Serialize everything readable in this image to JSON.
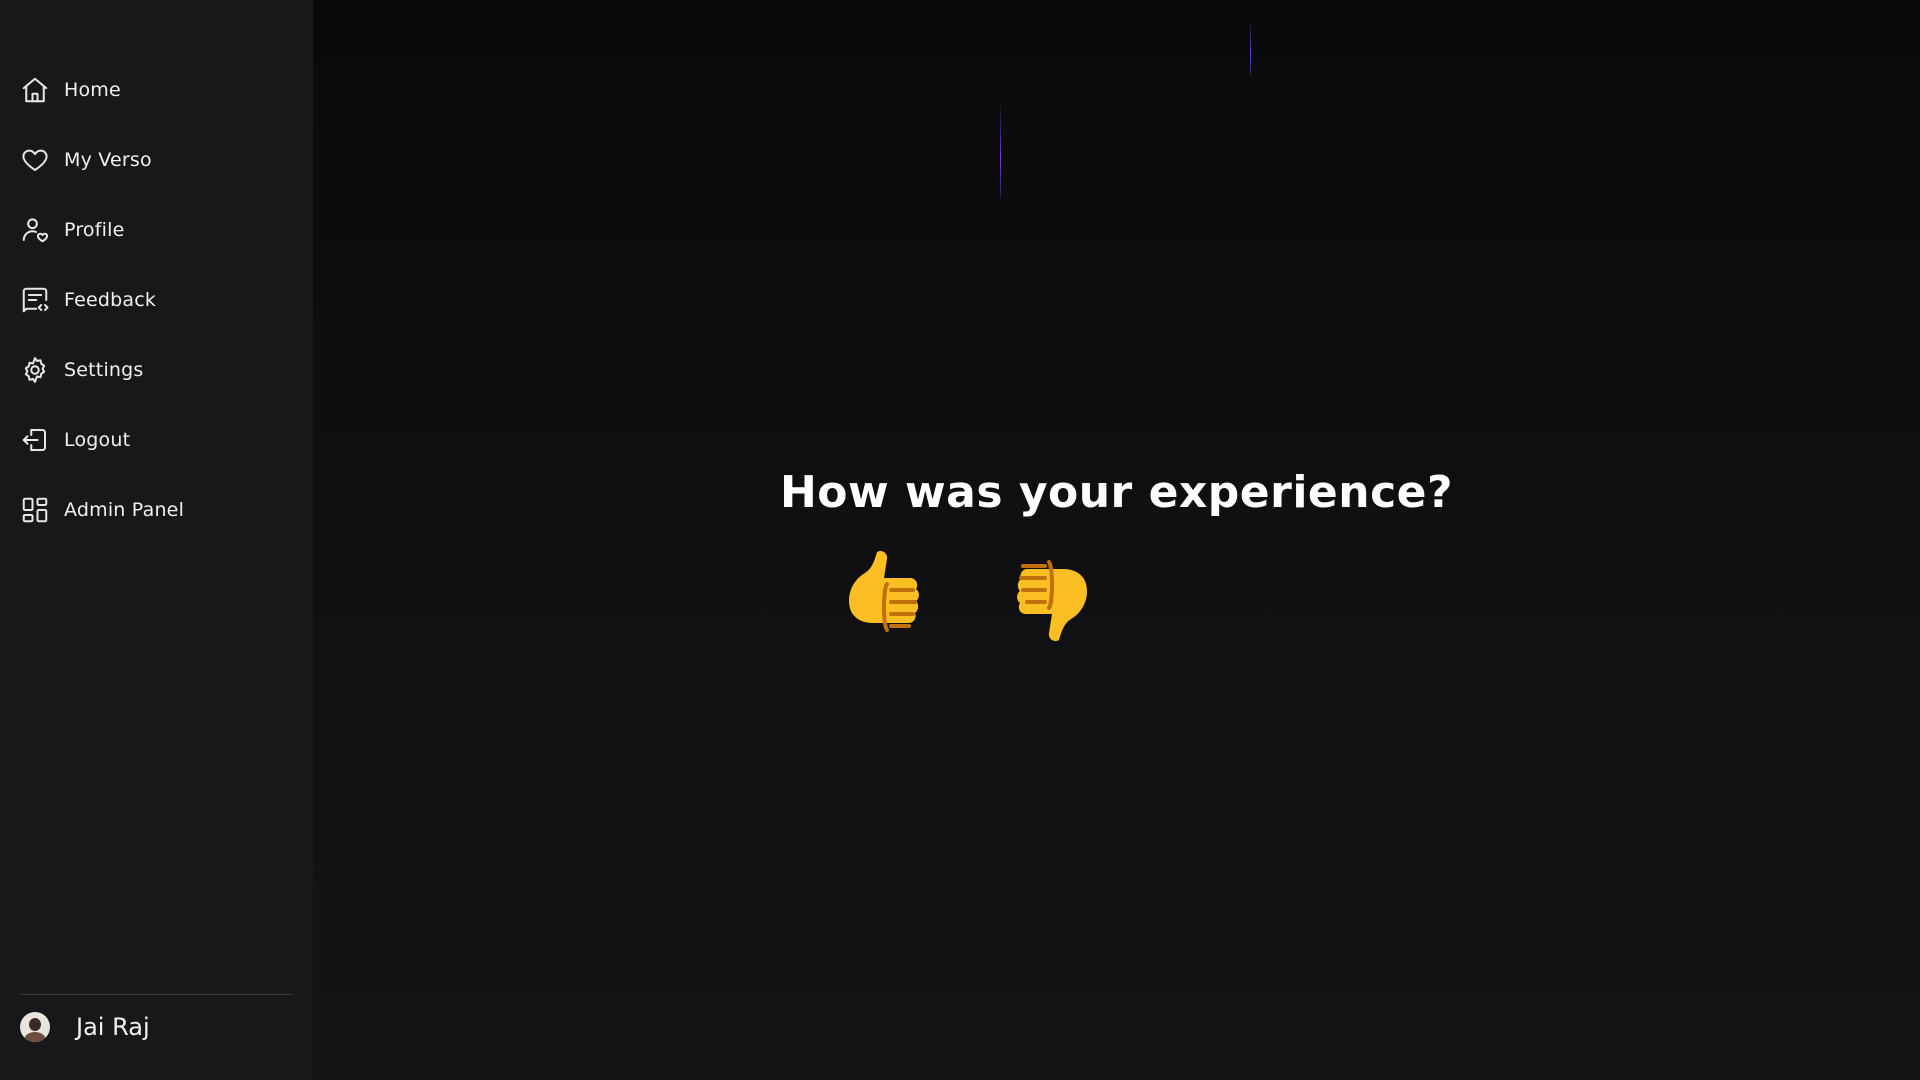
{
  "sidebar": {
    "items": [
      {
        "label": "Home",
        "icon": "home-icon"
      },
      {
        "label": "My Verso",
        "icon": "heart-icon"
      },
      {
        "label": "Profile",
        "icon": "user-heart-icon"
      },
      {
        "label": "Feedback",
        "icon": "feedback-icon"
      },
      {
        "label": "Settings",
        "icon": "gear-icon"
      },
      {
        "label": "Logout",
        "icon": "logout-icon"
      },
      {
        "label": "Admin Panel",
        "icon": "grid-icon"
      }
    ],
    "user": {
      "name": "Jai Raj"
    }
  },
  "main": {
    "question": "How was your experience?",
    "thumbs_up_icon": "thumbs-up-icon",
    "thumbs_down_icon": "thumbs-down-icon"
  },
  "colors": {
    "sidebar_bg": "#18181b",
    "main_bg": "#0d0d0f",
    "accent_streak": "#7c3aed",
    "emoji_yellow": "#fbbf24"
  }
}
